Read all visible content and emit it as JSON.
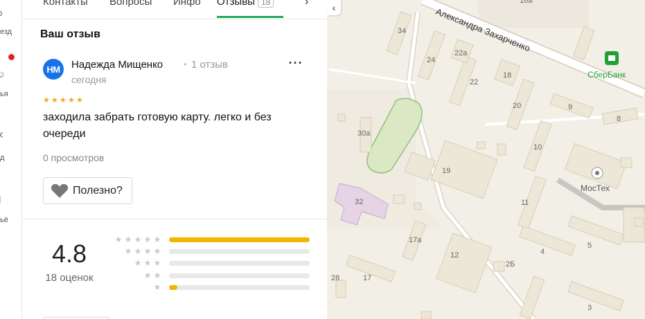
{
  "left_nav": {
    "items": [
      {
        "label": "езд",
        "icon": "route-icon"
      },
      {
        "label": "ья",
        "icon": "person-icon"
      },
      {
        "label": "д",
        "icon": "close-icon"
      },
      {
        "label": "ьё",
        "icon": "phone-icon"
      }
    ],
    "notification_dot_color": "#e2231a"
  },
  "tabs": {
    "items": [
      "Контакты",
      "Вопросы",
      "Инфо",
      "Отзывы"
    ],
    "active": "Отзывы",
    "badge": "18",
    "accent": "#1faa56"
  },
  "review": {
    "heading": "Ваш отзыв",
    "avatar_initials": "НМ",
    "author": "Надежда Мищенко",
    "author_reviews": "1 отзыв",
    "date": "сегодня",
    "stars": 5,
    "text": "заходила забрать готовую карту. легко и без очереди",
    "views": "0 просмотров",
    "helpful_label": "Полезно?",
    "more_icon": "more-dots-icon"
  },
  "rating": {
    "value": "4.8",
    "count": "18 оценок",
    "histogram": [
      {
        "stars": 5,
        "fraction": 1.0
      },
      {
        "stars": 4,
        "fraction": 0.0
      },
      {
        "stars": 3,
        "fraction": 0.0
      },
      {
        "stars": 2,
        "fraction": 0.0
      },
      {
        "stars": 1,
        "fraction": 0.06
      }
    ]
  },
  "map": {
    "street": "Александра Захарченко",
    "pois": [
      {
        "name": "СберБанк",
        "color": "#21a038"
      },
      {
        "name": "МосТех",
        "color": "#555555"
      }
    ],
    "house_numbers": [
      "34",
      "24",
      "22а",
      "18",
      "22",
      "20",
      "30а",
      "19",
      "10",
      "9",
      "8",
      "11",
      "32",
      "17а",
      "12",
      "4",
      "5",
      "2Б",
      "28",
      "17",
      "3",
      "16а"
    ]
  }
}
